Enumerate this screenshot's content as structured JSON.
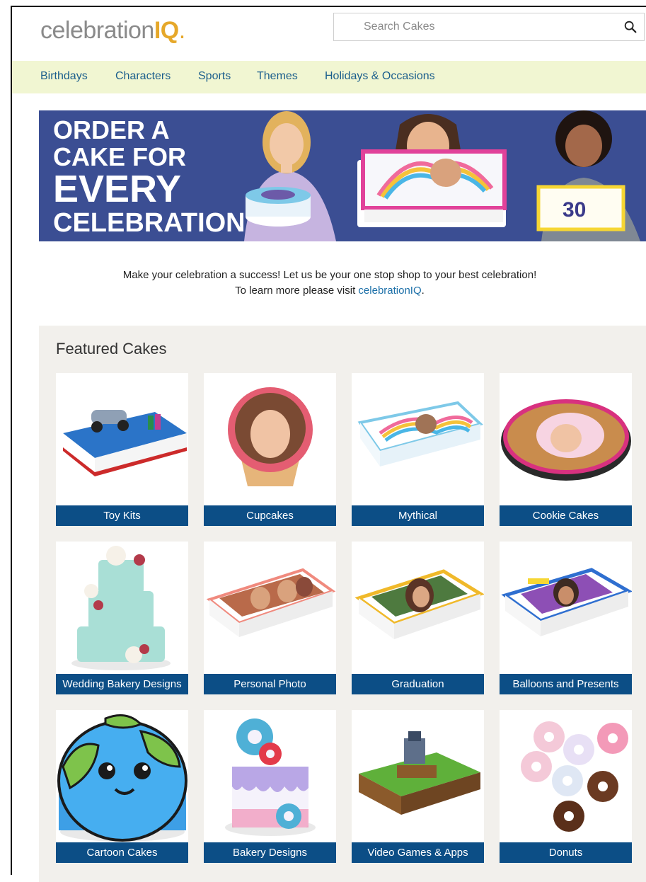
{
  "header": {
    "logo_text": "celebration",
    "logo_accent": "IQ",
    "search_placeholder": "Search Cakes"
  },
  "nav": {
    "items": [
      "Birthdays",
      "Characters",
      "Sports",
      "Themes",
      "Holidays & Occasions"
    ]
  },
  "banner": {
    "line1": "ORDER A",
    "line2": "CAKE FOR",
    "line3": "EVERY",
    "line4": "CELEBRATION!",
    "cake_number": "30"
  },
  "intro": {
    "line1": "Make your celebration a success! Let us be your one stop shop to your best celebration!",
    "line2_prefix": "To learn more please visit ",
    "line2_link": "celebrationIQ",
    "line2_suffix": "."
  },
  "featured": {
    "title": "Featured Cakes",
    "cards": [
      {
        "label": "Toy Kits"
      },
      {
        "label": "Cupcakes"
      },
      {
        "label": "Mythical"
      },
      {
        "label": "Cookie Cakes"
      },
      {
        "label": "Wedding Bakery Designs"
      },
      {
        "label": "Personal Photo"
      },
      {
        "label": "Graduation"
      },
      {
        "label": "Balloons and Presents"
      },
      {
        "label": "Cartoon Cakes"
      },
      {
        "label": "Bakery Designs"
      },
      {
        "label": "Video Games & Apps"
      },
      {
        "label": "Donuts"
      }
    ]
  },
  "colors": {
    "nav_bg": "#f1f6d2",
    "banner_bg": "#3b4e93",
    "label_bg": "#0c4e86",
    "link": "#1b6fa8",
    "accent": "#e6a82a"
  }
}
